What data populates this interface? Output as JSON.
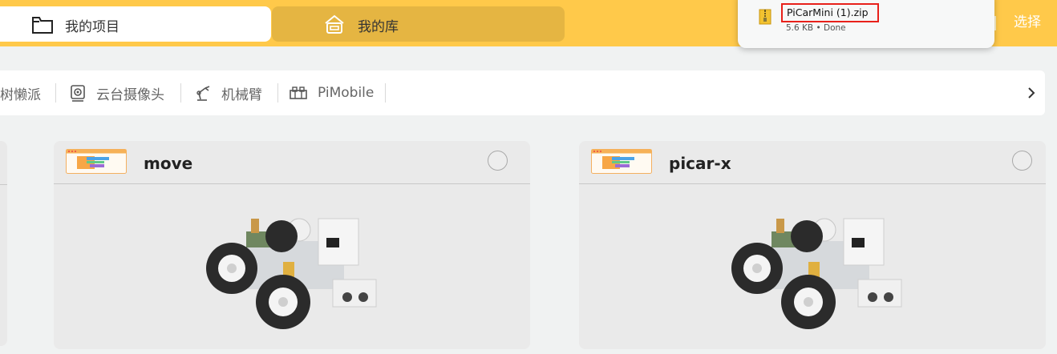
{
  "header": {
    "tabs": [
      {
        "label": "我的项目",
        "icon": "folder-icon",
        "active": true
      },
      {
        "label": "我的库",
        "icon": "library-icon",
        "active": false
      }
    ],
    "select_label": "选择",
    "accent_color": "#ffc94a"
  },
  "download": {
    "file_name": "PiCarMini (1).zip",
    "status": "5.6 KB • Done",
    "icon": "zip-file-icon"
  },
  "categories": [
    {
      "label": "树懒派",
      "icon": ""
    },
    {
      "label": "云台摄像头",
      "icon": "camera-icon"
    },
    {
      "label": "机械臂",
      "icon": "robot-arm-icon"
    },
    {
      "label": "PiMobile",
      "icon": "pimobile-icon"
    }
  ],
  "projects": [
    {
      "title": "move",
      "thumbnail": "project-thumbnail",
      "image": "robot-car-image",
      "selected": false
    },
    {
      "title": "picar-x",
      "thumbnail": "project-thumbnail",
      "image": "robot-car-image",
      "selected": false
    }
  ]
}
